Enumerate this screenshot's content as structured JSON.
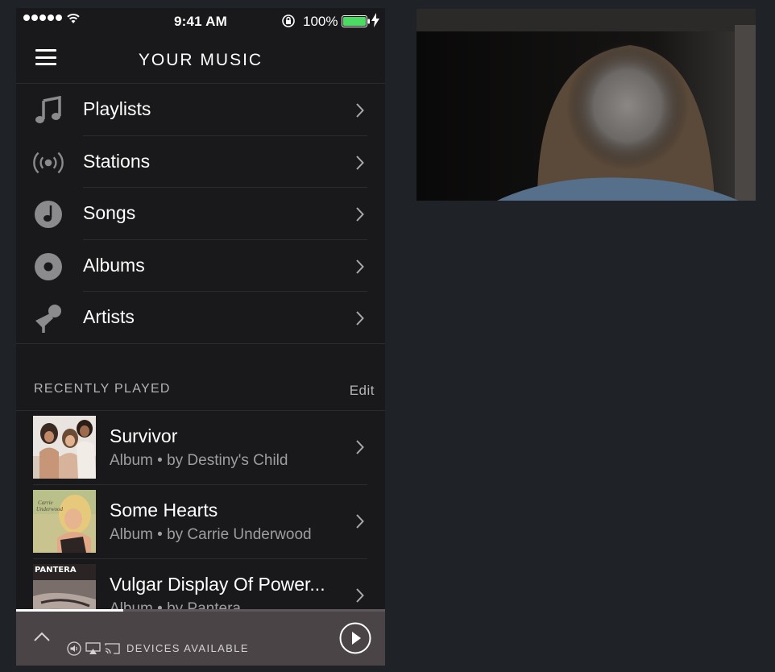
{
  "status_bar": {
    "time": "9:41 AM",
    "battery_percent": "100%",
    "battery_level": 1.0,
    "signal_bars": 5,
    "battery_color": "#4cd964"
  },
  "header": {
    "title": "YOUR MUSIC"
  },
  "menu": [
    {
      "label": "Playlists",
      "icon": "music-note-icon"
    },
    {
      "label": "Stations",
      "icon": "radio-broadcast-icon"
    },
    {
      "label": "Songs",
      "icon": "song-disc-icon"
    },
    {
      "label": "Albums",
      "icon": "album-disc-icon"
    },
    {
      "label": "Artists",
      "icon": "microphone-icon"
    }
  ],
  "recently_played": {
    "heading": "RECENTLY PLAYED",
    "edit_label": "Edit",
    "items": [
      {
        "title": "Survivor",
        "subtitle": "Album • by Destiny's Child"
      },
      {
        "title": "Some Hearts",
        "subtitle": "Album • by Carrie Underwood"
      },
      {
        "title": "Vulgar Display Of Power...",
        "subtitle": "Album • by Pantera",
        "cover_text": "PANTERA"
      }
    ]
  },
  "now_playing_bar": {
    "devices_label": "DEVICES AVAILABLE",
    "progress": 0.29
  },
  "colors": {
    "panel_bg": "#19181a",
    "page_bg": "#1f2327",
    "now_bar_bg": "#4b4446"
  }
}
